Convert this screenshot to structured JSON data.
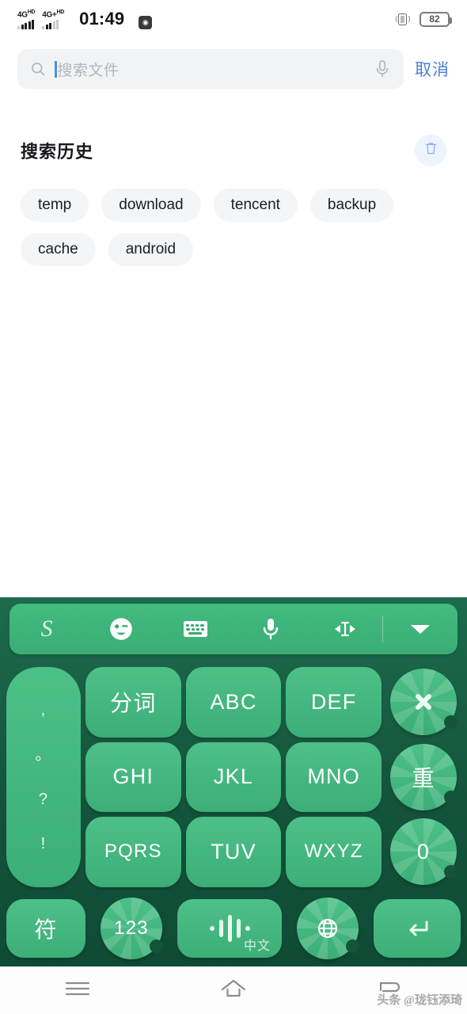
{
  "status_bar": {
    "signal_1": {
      "network": "4G",
      "suffix": "HD"
    },
    "signal_2": {
      "network": "4G+",
      "suffix": "HD"
    },
    "time": "01:49",
    "app_icon": "camera-icon",
    "vibrate_icon": "vibrate-icon",
    "battery_percent": "82"
  },
  "search": {
    "search_icon": "search-icon",
    "placeholder": "搜索文件",
    "value": "",
    "mic_icon": "microphone-icon",
    "cancel_label": "取消"
  },
  "history": {
    "title": "搜索历史",
    "clear_icon": "trash-icon",
    "chips": [
      "temp",
      "download",
      "tencent",
      "backup",
      "cache",
      "android"
    ]
  },
  "keyboard": {
    "toolbar": [
      {
        "name": "sogou-logo-icon",
        "label": "S"
      },
      {
        "name": "emoji-icon",
        "label": ""
      },
      {
        "name": "keyboard-switch-icon",
        "label": ""
      },
      {
        "name": "voice-input-icon",
        "label": ""
      },
      {
        "name": "cursor-move-icon",
        "label": ""
      },
      {
        "name": "collapse-keyboard-icon",
        "label": ""
      }
    ],
    "punctuation_key": [
      ",",
      "。",
      "?",
      "!"
    ],
    "keys": [
      {
        "name": "key-fenci",
        "label": "分词",
        "type": "rect"
      },
      {
        "name": "key-abc",
        "label": "ABC",
        "type": "rect"
      },
      {
        "name": "key-def",
        "label": "DEF",
        "type": "rect"
      },
      {
        "name": "key-backspace",
        "label": "✕",
        "type": "round"
      },
      {
        "name": "key-ghi",
        "label": "GHI",
        "type": "rect"
      },
      {
        "name": "key-jkl",
        "label": "JKL",
        "type": "rect"
      },
      {
        "name": "key-mno",
        "label": "MNO",
        "type": "rect"
      },
      {
        "name": "key-repeat",
        "label": "重",
        "type": "round"
      },
      {
        "name": "key-pqrs",
        "label": "PQRS",
        "type": "rect"
      },
      {
        "name": "key-tuv",
        "label": "TUV",
        "type": "rect"
      },
      {
        "name": "key-wxyz",
        "label": "WXYZ",
        "type": "rect"
      },
      {
        "name": "key-zero",
        "label": "0",
        "type": "round"
      }
    ],
    "bottom_row": {
      "symbol_label": "符",
      "numeric_label": "123",
      "space_label": "中文",
      "globe_icon": "globe-icon",
      "enter_icon": "enter-icon"
    }
  },
  "nav_bar": {
    "menu_icon": "menu-icon",
    "home_icon": "home-icon",
    "back_icon": "back-icon"
  },
  "watermark": "头条 @珑钰添琦",
  "colors": {
    "keyboard_bg": "#14543c",
    "key_green": "#3cae77",
    "toolbar_green": "#3fb87a",
    "accent_blue": "#4a7fd4",
    "chip_bg": "#f4f5f6"
  }
}
